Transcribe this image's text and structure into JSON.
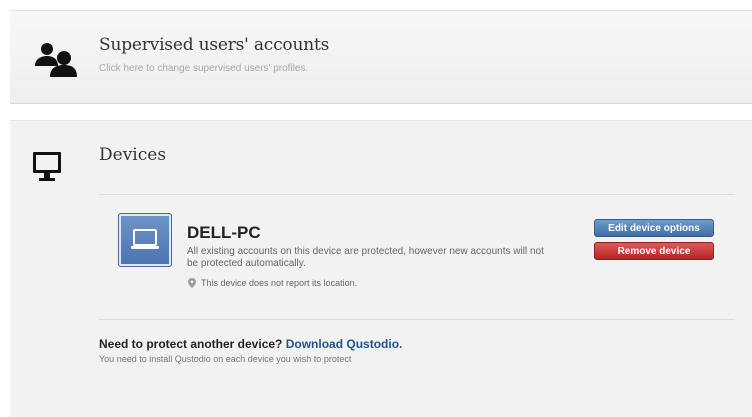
{
  "supervised_users": {
    "title": "Supervised users' accounts",
    "subtitle": "Click here to change supervised users' profiles.",
    "icon": "users-icon"
  },
  "devices": {
    "title": "Devices",
    "icon": "monitor-icon",
    "device": {
      "name": "DELL-PC",
      "icon": "laptop-icon",
      "status": "All existing accounts on this device are protected, however new accounts will not be protected automatically.",
      "location_note": "This device does not report its location.",
      "edit_button": "Edit device options",
      "remove_button": "Remove device"
    },
    "protect": {
      "question": "Need to protect another device?",
      "link": "Download Qustodio.",
      "note": "You need to install Qustodio on each device you wish to protect"
    }
  },
  "colors": {
    "edit_button": "#4a78ad",
    "remove_button": "#c83a3a",
    "link": "#21548f",
    "device_tile": "#5b82bb"
  }
}
